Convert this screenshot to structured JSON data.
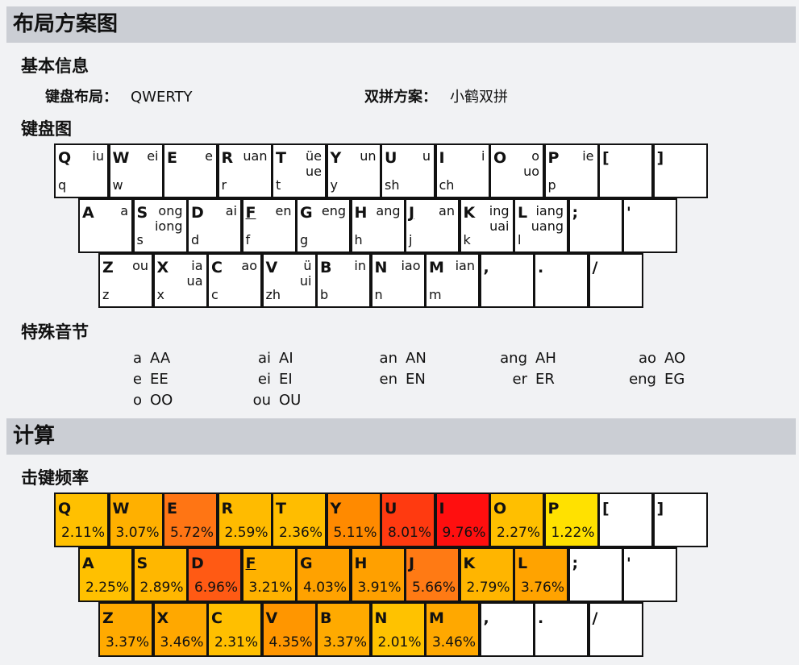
{
  "sections": {
    "layout_title": "布局方案图",
    "calc_title": "计算"
  },
  "basic": {
    "title": "基本信息",
    "layout_label": "键盘布局：",
    "layout_value": "QWERTY",
    "scheme_label": "双拼方案：",
    "scheme_value": "小鹤双拼"
  },
  "keyboard": {
    "title": "键盘图",
    "rows": [
      [
        {
          "k": "Q",
          "i": "q",
          "f": [
            "iu"
          ]
        },
        {
          "k": "W",
          "i": "w",
          "f": [
            "ei"
          ]
        },
        {
          "k": "E",
          "i": "",
          "f": [
            "e"
          ]
        },
        {
          "k": "R",
          "i": "r",
          "f": [
            "uan"
          ]
        },
        {
          "k": "T",
          "i": "t",
          "f": [
            "üe",
            "ue"
          ]
        },
        {
          "k": "Y",
          "i": "y",
          "f": [
            "un"
          ]
        },
        {
          "k": "U",
          "i": "sh",
          "f": [
            "u"
          ]
        },
        {
          "k": "I",
          "i": "ch",
          "f": [
            "i"
          ]
        },
        {
          "k": "O",
          "i": "",
          "f": [
            "o",
            "uo"
          ]
        },
        {
          "k": "P",
          "i": "p",
          "f": [
            "ie"
          ]
        },
        {
          "k": "[",
          "i": "",
          "f": []
        },
        {
          "k": "]",
          "i": "",
          "f": []
        }
      ],
      [
        {
          "k": "A",
          "i": "",
          "f": [
            "a"
          ]
        },
        {
          "k": "S",
          "i": "s",
          "f": [
            "ong",
            "iong"
          ]
        },
        {
          "k": "D",
          "i": "d",
          "f": [
            "ai"
          ]
        },
        {
          "k": "F",
          "i": "f",
          "f": [
            "en"
          ],
          "u": true
        },
        {
          "k": "G",
          "i": "g",
          "f": [
            "eng"
          ]
        },
        {
          "k": "H",
          "i": "h",
          "f": [
            "ang"
          ]
        },
        {
          "k": "J",
          "i": "j",
          "f": [
            "an"
          ],
          "u": true
        },
        {
          "k": "K",
          "i": "k",
          "f": [
            "ing",
            "uai"
          ]
        },
        {
          "k": "L",
          "i": "l",
          "f": [
            "iang",
            "uang"
          ]
        },
        {
          "k": ";",
          "i": "",
          "f": []
        },
        {
          "k": "'",
          "i": "",
          "f": []
        }
      ],
      [
        {
          "k": "Z",
          "i": "z",
          "f": [
            "ou"
          ]
        },
        {
          "k": "X",
          "i": "x",
          "f": [
            "ia",
            "ua"
          ]
        },
        {
          "k": "C",
          "i": "c",
          "f": [
            "ao"
          ]
        },
        {
          "k": "V",
          "i": "zh",
          "f": [
            "ü",
            "ui"
          ]
        },
        {
          "k": "B",
          "i": "b",
          "f": [
            "in"
          ]
        },
        {
          "k": "N",
          "i": "n",
          "f": [
            "iao"
          ]
        },
        {
          "k": "M",
          "i": "m",
          "f": [
            "ian"
          ]
        },
        {
          "k": ",",
          "i": "",
          "f": []
        },
        {
          "k": ".",
          "i": "",
          "f": []
        },
        {
          "k": "/",
          "i": "",
          "f": []
        }
      ]
    ]
  },
  "special": {
    "title": "特殊音节",
    "rows": [
      [
        [
          "a",
          "AA"
        ],
        [
          "ai",
          "AI"
        ],
        [
          "an",
          "AN"
        ],
        [
          "ang",
          "AH"
        ],
        [
          "ao",
          "AO"
        ]
      ],
      [
        [
          "e",
          "EE"
        ],
        [
          "ei",
          "EI"
        ],
        [
          "en",
          "EN"
        ],
        [
          "er",
          "ER"
        ],
        [
          "eng",
          "EG"
        ]
      ],
      [
        [
          "o",
          "OO"
        ],
        [
          "ou",
          "OU"
        ]
      ]
    ]
  },
  "frequency": {
    "title": "击键频率",
    "rows": [
      [
        {
          "k": "Q",
          "p": "2.11%",
          "c": "#ffc000"
        },
        {
          "k": "W",
          "p": "3.07%",
          "c": "#ffb000"
        },
        {
          "k": "E",
          "p": "5.72%",
          "c": "#ff7514"
        },
        {
          "k": "R",
          "p": "2.59%",
          "c": "#ffbb00"
        },
        {
          "k": "T",
          "p": "2.36%",
          "c": "#ffbd00"
        },
        {
          "k": "Y",
          "p": "5.11%",
          "c": "#ff8a00"
        },
        {
          "k": "U",
          "p": "8.01%",
          "c": "#ff3a10"
        },
        {
          "k": "I",
          "p": "9.76%",
          "c": "#ff0f0f"
        },
        {
          "k": "O",
          "p": "2.27%",
          "c": "#ffbf00"
        },
        {
          "k": "P",
          "p": "1.22%",
          "c": "#ffe100"
        },
        {
          "k": "[",
          "p": "",
          "c": "#ffffff"
        },
        {
          "k": "]",
          "p": "",
          "c": "#ffffff"
        }
      ],
      [
        {
          "k": "A",
          "p": "2.25%",
          "c": "#ffc000"
        },
        {
          "k": "S",
          "p": "2.89%",
          "c": "#ffb700"
        },
        {
          "k": "D",
          "p": "6.96%",
          "c": "#ff5a14"
        },
        {
          "k": "F",
          "p": "3.21%",
          "c": "#ffb200",
          "u": true
        },
        {
          "k": "G",
          "p": "4.03%",
          "c": "#ffa200"
        },
        {
          "k": "H",
          "p": "3.91%",
          "c": "#ffa000"
        },
        {
          "k": "J",
          "p": "5.66%",
          "c": "#ff7a14",
          "u": true
        },
        {
          "k": "K",
          "p": "2.79%",
          "c": "#ffb500"
        },
        {
          "k": "L",
          "p": "3.76%",
          "c": "#ffa300"
        },
        {
          "k": ";",
          "p": "",
          "c": "#ffffff"
        },
        {
          "k": "'",
          "p": "",
          "c": "#ffffff"
        }
      ],
      [
        {
          "k": "Z",
          "p": "3.37%",
          "c": "#ffaa00"
        },
        {
          "k": "X",
          "p": "3.46%",
          "c": "#ffa800"
        },
        {
          "k": "C",
          "p": "2.31%",
          "c": "#ffbf00"
        },
        {
          "k": "V",
          "p": "4.35%",
          "c": "#ff9600"
        },
        {
          "k": "B",
          "p": "3.37%",
          "c": "#ffaa00"
        },
        {
          "k": "N",
          "p": "2.01%",
          "c": "#ffc200"
        },
        {
          "k": "M",
          "p": "3.46%",
          "c": "#ffa800"
        },
        {
          "k": ",",
          "p": "",
          "c": "#ffffff"
        },
        {
          "k": ".",
          "p": "",
          "c": "#ffffff"
        },
        {
          "k": "/",
          "p": "",
          "c": "#ffffff"
        }
      ]
    ]
  }
}
